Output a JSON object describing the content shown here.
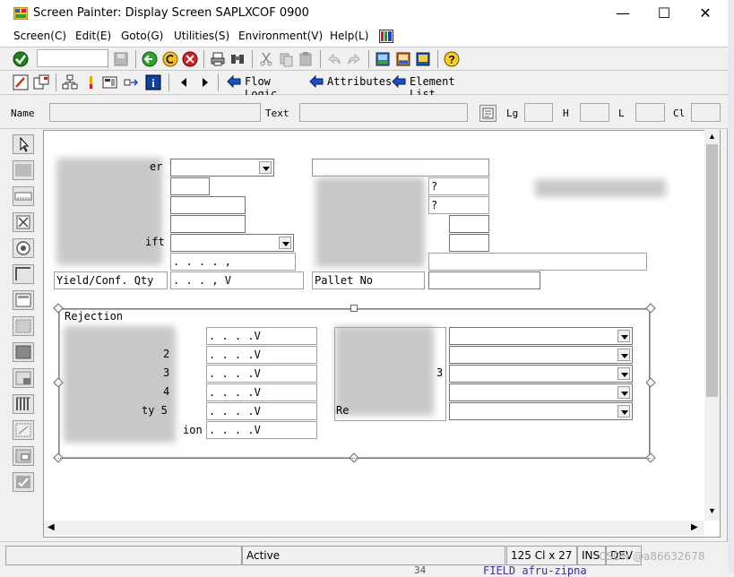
{
  "window": {
    "title": "Screen Painter:  Display Screen SAPLXCOF 0900",
    "controls": [
      "—",
      "☐",
      "✕"
    ]
  },
  "menu": [
    "Screen(C)",
    "Edit(E)",
    "Goto(G)",
    "Utilities(S)",
    "Environment(V)",
    "Help(L)"
  ],
  "toolbar2": {
    "flow_logic": "Flow Logic",
    "attributes": "Attributes",
    "element_list": "Element List"
  },
  "attr": {
    "name": "Name",
    "text": "Text",
    "lg": "Lg",
    "h": "H",
    "l": "L",
    "cl": "Cl"
  },
  "form": {
    "row_qty": "Yield/Conf. Qty",
    "row_qty_value": " .   .   .   ,   V",
    "pallet": "Pallet No",
    "field_q1": "?",
    "field_q2": "?",
    "row5_value": " .   .   .   .   ,",
    "rejection_title": "Rejection",
    "rej_nums": [
      "2",
      "3",
      "4",
      "5"
    ],
    "rej_values": [
      " .   .   .   .V",
      " .   .   .   .V",
      " .   .   .   .V",
      " .   .   .   .V",
      " .   .   .   .V",
      " .   .   .   .V"
    ],
    "rej_last_label": "ion",
    "rej_labels_frag": [
      "R",
      "I",
      "R",
      "Re"
    ],
    "rej_label_5": "ty 5",
    "trunc_er": "er",
    "trunc_lift": "ift"
  },
  "status": {
    "mode": "Active",
    "position": "125 Cl x 27 L",
    "ins": "INS",
    "dev": "DEV"
  },
  "watermark": "CSDN @a86632678",
  "bg_code": "FIELD afru-zipna",
  "bg_lineno": "34"
}
